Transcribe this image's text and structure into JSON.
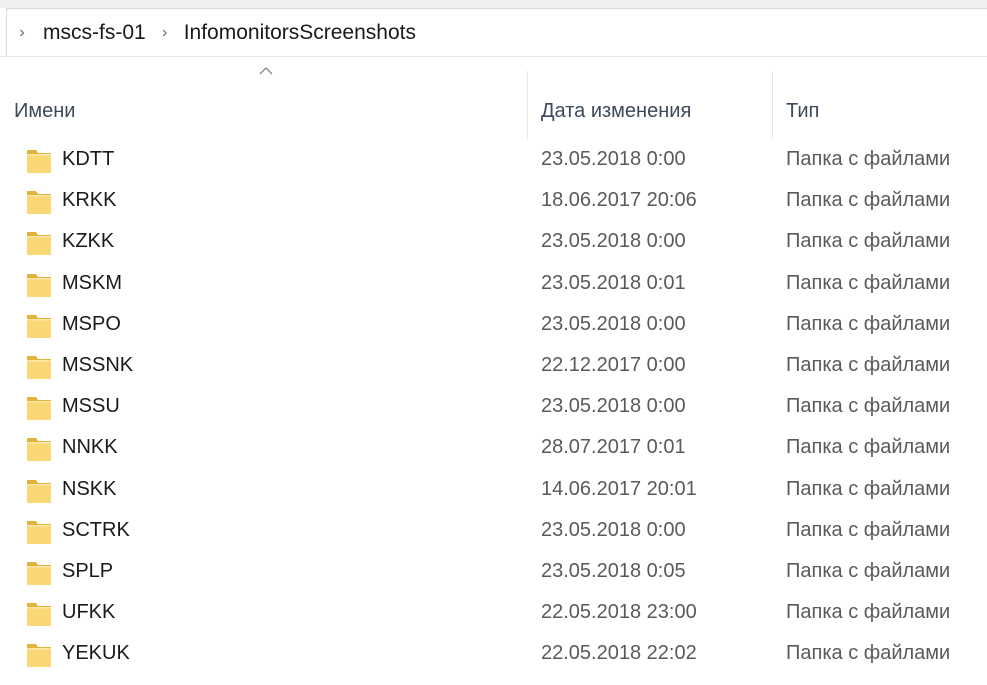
{
  "breadcrumb": {
    "items": [
      {
        "label": "mscs-fs-01"
      },
      {
        "label": "InfomonitorsScreenshots"
      }
    ],
    "separator": "›"
  },
  "columns": {
    "name": "Имени",
    "date": "Дата изменения",
    "type": "Тип",
    "sorted_column": "name",
    "sort_direction": "ascending"
  },
  "colors": {
    "folder": "#f8d774",
    "folder_dark": "#e0b43a",
    "header_text": "#3c4a5a",
    "secondary_text": "#5a5a5a"
  },
  "files": [
    {
      "name": "KDTT",
      "date": "23.05.2018 0:00",
      "type": "Папка с файлами",
      "icon": "folder-icon"
    },
    {
      "name": "KRKK",
      "date": "18.06.2017 20:06",
      "type": "Папка с файлами",
      "icon": "folder-icon"
    },
    {
      "name": "KZKK",
      "date": "23.05.2018 0:00",
      "type": "Папка с файлами",
      "icon": "folder-icon"
    },
    {
      "name": "MSKM",
      "date": "23.05.2018 0:01",
      "type": "Папка с файлами",
      "icon": "folder-icon"
    },
    {
      "name": "MSPO",
      "date": "23.05.2018 0:00",
      "type": "Папка с файлами",
      "icon": "folder-icon"
    },
    {
      "name": "MSSNK",
      "date": "22.12.2017 0:00",
      "type": "Папка с файлами",
      "icon": "folder-icon"
    },
    {
      "name": "MSSU",
      "date": "23.05.2018 0:00",
      "type": "Папка с файлами",
      "icon": "folder-icon"
    },
    {
      "name": "NNKK",
      "date": "28.07.2017 0:01",
      "type": "Папка с файлами",
      "icon": "folder-icon"
    },
    {
      "name": "NSKK",
      "date": "14.06.2017 20:01",
      "type": "Папка с файлами",
      "icon": "folder-icon"
    },
    {
      "name": "SCTRK",
      "date": "23.05.2018 0:00",
      "type": "Папка с файлами",
      "icon": "folder-icon"
    },
    {
      "name": "SPLP",
      "date": "23.05.2018 0:05",
      "type": "Папка с файлами",
      "icon": "folder-icon"
    },
    {
      "name": "UFKK",
      "date": "22.05.2018 23:00",
      "type": "Папка с файлами",
      "icon": "folder-icon"
    },
    {
      "name": "YEKUK",
      "date": "22.05.2018 22:02",
      "type": "Папка с файлами",
      "icon": "folder-icon"
    }
  ]
}
